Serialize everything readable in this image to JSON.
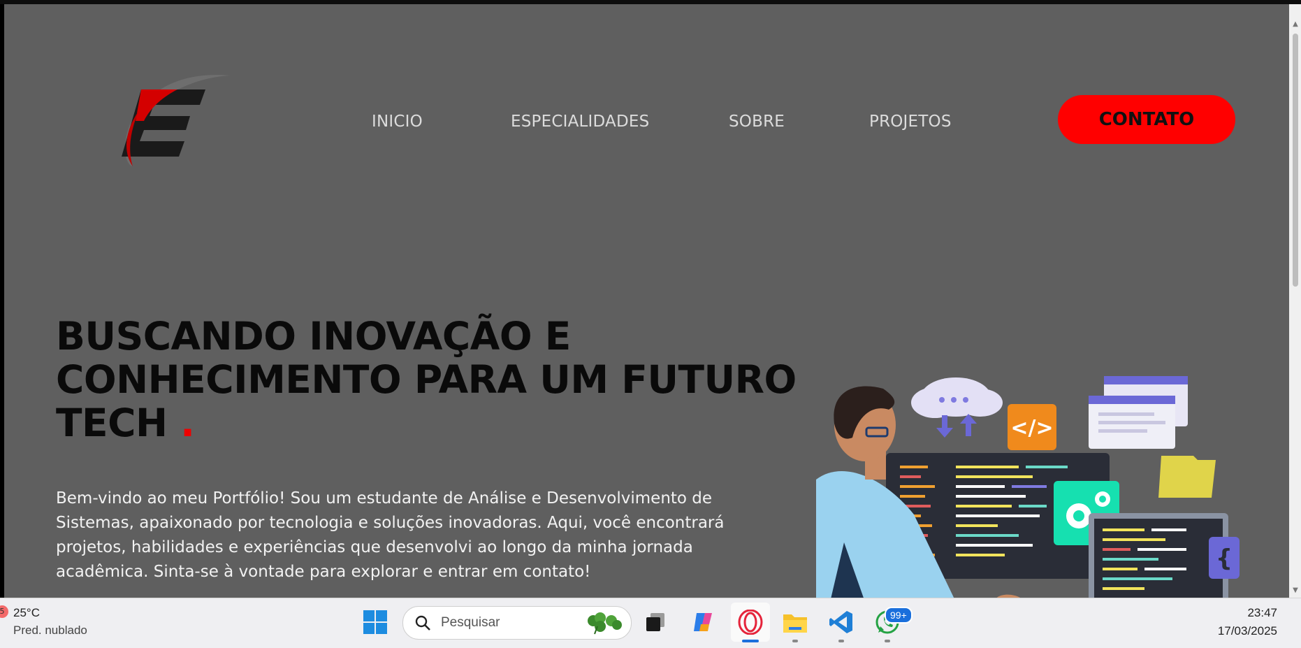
{
  "nav": {
    "links": [
      "INICIO",
      "ESPECIALIDADES",
      "SOBRE",
      "PROJETOS"
    ],
    "contact_label": "CONTATO"
  },
  "hero": {
    "title_line1": "BUSCANDO INOVAÇÃO E",
    "title_line2": "CONHECIMENTO PARA UM FUTURO",
    "title_line3": "TECH",
    "title_dot": ".",
    "intro": "Bem-vindo ao meu Portfólio! Sou um estudante de Análise e Desenvolvimento de Sistemas, apaixonado por tecnologia e soluções inovadoras. Aqui, você encontrará projetos, habilidades e experiências que desenvolvi ao longo da minha jornada acadêmica. Sinta-se à vontade para explorar e entrar em contato!"
  },
  "taskbar": {
    "weather_badge": "5",
    "weather_temp": "25°C",
    "weather_desc": "Pred. nublado",
    "search_placeholder": "Pesquisar",
    "whatsapp_badge": "99+",
    "time": "23:47",
    "date": "17/03/2025"
  },
  "colors": {
    "page_bg": "#5f5f5f",
    "accent": "#ff0000",
    "nav_text": "#dcdcdc",
    "title_text": "#0a0a0a"
  },
  "icons": [
    "logo-e",
    "windows-start-icon",
    "search-icon",
    "task-view-icon",
    "copilot-icon",
    "opera-icon",
    "file-explorer-icon",
    "vscode-icon",
    "whatsapp-icon"
  ]
}
